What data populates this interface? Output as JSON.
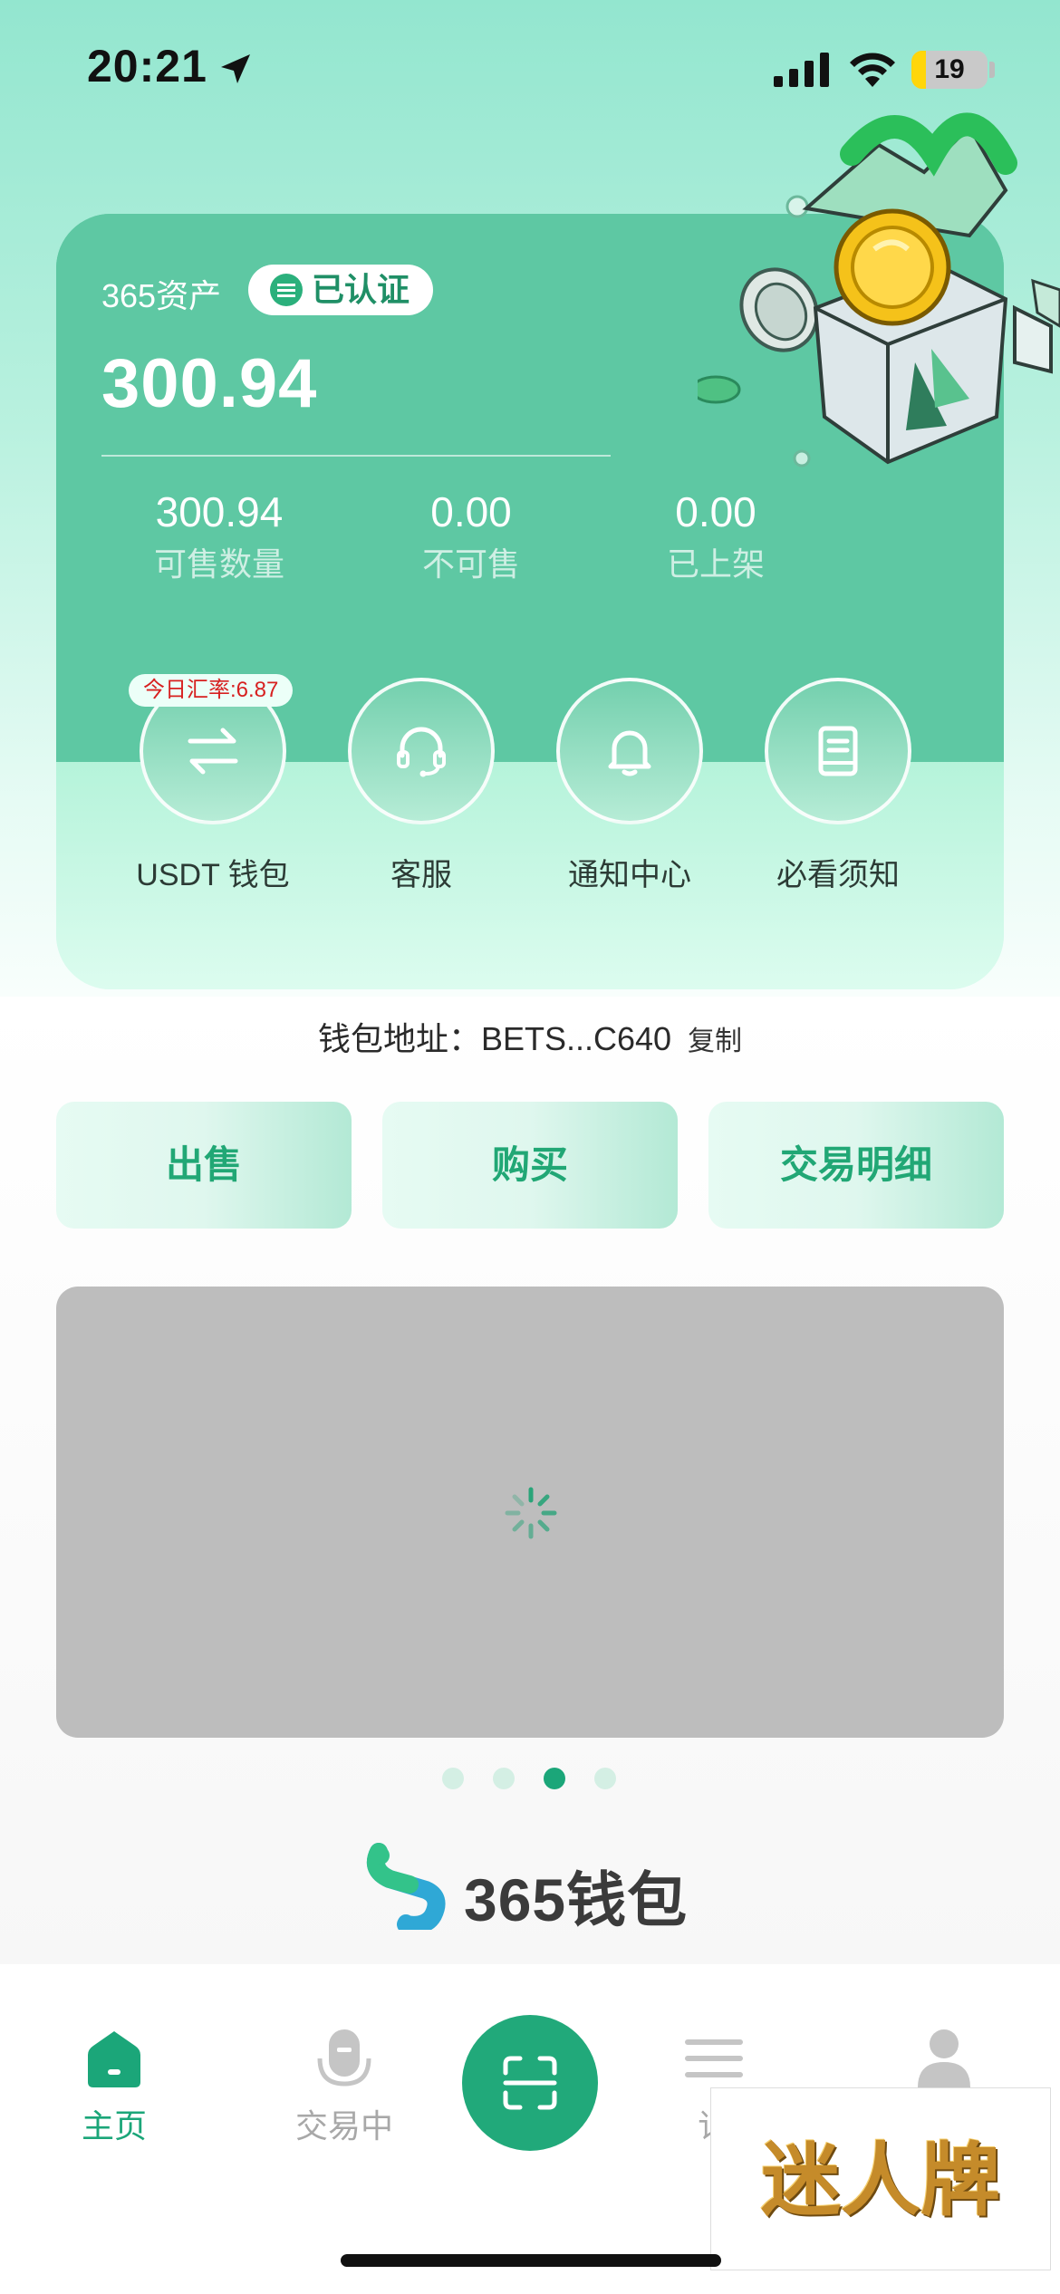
{
  "status_bar": {
    "time": "20:21",
    "battery": "19",
    "battery_level": 0.19
  },
  "asset_card": {
    "label": "365资产",
    "verified": "已认证",
    "total": "300.94",
    "stats": [
      {
        "value": "300.94",
        "label": "可售数量"
      },
      {
        "value": "0.00",
        "label": "不可售"
      },
      {
        "value": "0.00",
        "label": "已上架"
      }
    ],
    "rate_badge": "今日汇率:6.87",
    "quick_actions": [
      {
        "label": "USDT 钱包",
        "icon": "swap-icon"
      },
      {
        "label": "客服",
        "icon": "headset-icon"
      },
      {
        "label": "通知中心",
        "icon": "bell-icon"
      },
      {
        "label": "必看须知",
        "icon": "document-icon"
      }
    ]
  },
  "wallet": {
    "address": "钱包地址：BETS...C640",
    "copy_label": "复制"
  },
  "actions": [
    {
      "label": "出售"
    },
    {
      "label": "购买"
    },
    {
      "label": "交易明细"
    }
  ],
  "carousel": {
    "active_index": 2,
    "count": 4
  },
  "logo": {
    "text": "365钱包"
  },
  "tabbar": {
    "items": [
      {
        "label": "主页",
        "icon": "home-icon",
        "active": true
      },
      {
        "label": "交易中",
        "icon": "microphone-icon",
        "active": false
      },
      {
        "label": "",
        "icon": "scan-icon",
        "active": false
      },
      {
        "label": "订",
        "icon": "list-icon",
        "active": false
      },
      {
        "label": "",
        "icon": "user-icon",
        "active": false
      }
    ]
  },
  "overlay_stamp": {
    "text": "迷人牌"
  },
  "colors": {
    "accent": "#1ba679",
    "card_green": "#5ec8a3",
    "rate_red": "#d72020"
  }
}
